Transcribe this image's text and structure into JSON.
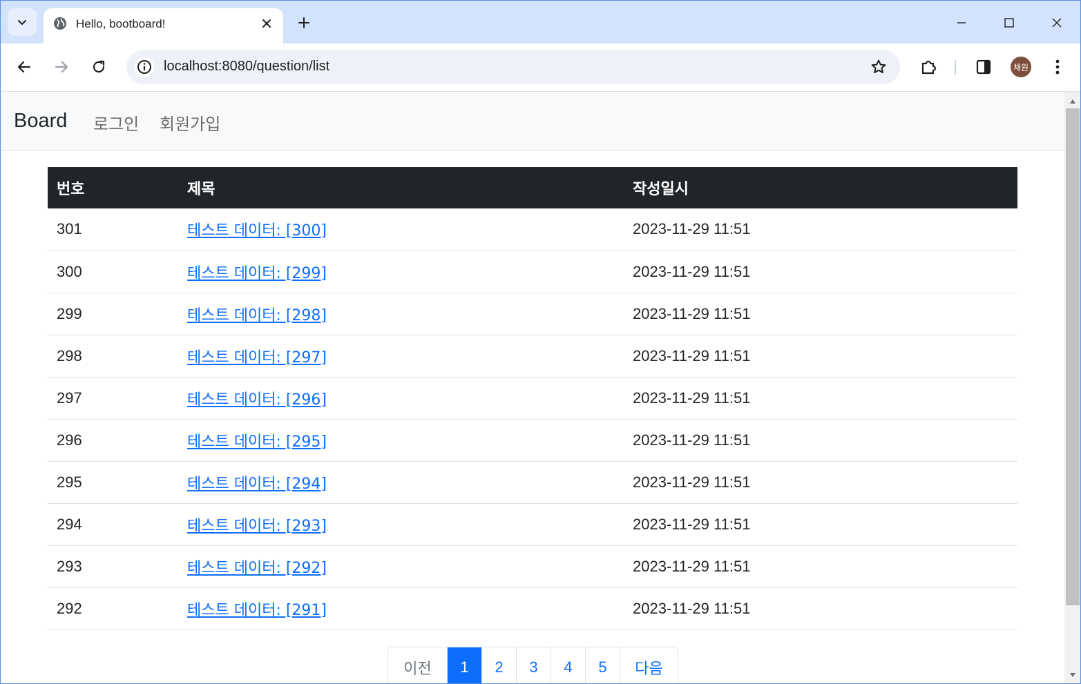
{
  "browser": {
    "tab_title": "Hello, bootboard!",
    "url": "localhost:8080/question/list",
    "profile_initials": "채원"
  },
  "icons": {
    "tab_search": "chevron-down-icon",
    "favicon": "globe-icon",
    "tab_close": "close-icon",
    "new_tab": "plus-icon",
    "back": "arrow-left-icon",
    "forward": "arrow-right-icon",
    "reload": "reload-icon",
    "site_info": "info-icon",
    "bookmark": "star-icon",
    "extensions": "puzzle-icon",
    "side_panel": "side-panel-icon",
    "menu": "kebab-menu-icon"
  },
  "colors": {
    "tabstrip": "#d3e3fd",
    "table_header": "#212529",
    "link": "#0d6efd",
    "active_page": "#0d6efd"
  },
  "navbar": {
    "brand": "Board",
    "links": [
      "로그인",
      "회원가입"
    ]
  },
  "table": {
    "headers": [
      "번호",
      "제목",
      "작성일시"
    ],
    "rows": [
      {
        "no": "301",
        "subject": "테스트 데이터: [300]",
        "date": "2023-11-29 11:51"
      },
      {
        "no": "300",
        "subject": "테스트 데이터: [299]",
        "date": "2023-11-29 11:51"
      },
      {
        "no": "299",
        "subject": "테스트 데이터: [298]",
        "date": "2023-11-29 11:51"
      },
      {
        "no": "298",
        "subject": "테스트 데이터: [297]",
        "date": "2023-11-29 11:51"
      },
      {
        "no": "297",
        "subject": "테스트 데이터: [296]",
        "date": "2023-11-29 11:51"
      },
      {
        "no": "296",
        "subject": "테스트 데이터: [295]",
        "date": "2023-11-29 11:51"
      },
      {
        "no": "295",
        "subject": "테스트 데이터: [294]",
        "date": "2023-11-29 11:51"
      },
      {
        "no": "294",
        "subject": "테스트 데이터: [293]",
        "date": "2023-11-29 11:51"
      },
      {
        "no": "293",
        "subject": "테스트 데이터: [292]",
        "date": "2023-11-29 11:51"
      },
      {
        "no": "292",
        "subject": "테스트 데이터: [291]",
        "date": "2023-11-29 11:51"
      }
    ]
  },
  "pagination": {
    "prev": "이전",
    "pages": [
      "1",
      "2",
      "3",
      "4",
      "5"
    ],
    "active": "1",
    "next": "다음"
  }
}
